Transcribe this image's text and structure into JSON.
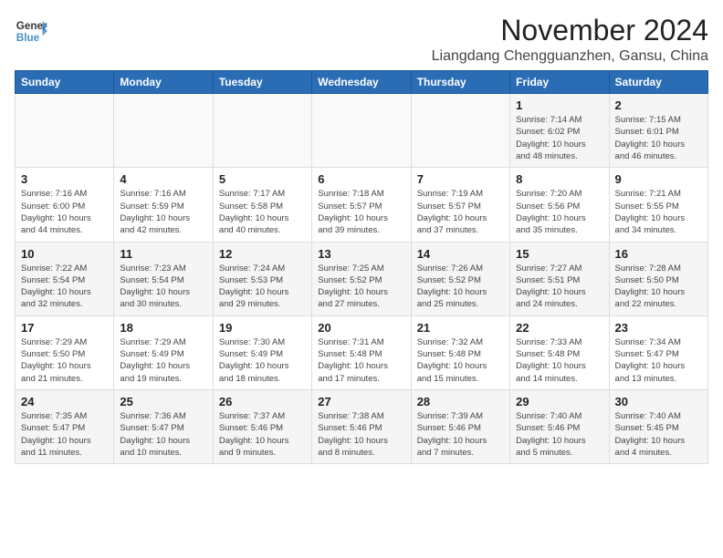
{
  "header": {
    "logo_line1": "General",
    "logo_line2": "Blue",
    "month": "November 2024",
    "location": "Liangdang Chengguanzhen, Gansu, China"
  },
  "weekdays": [
    "Sunday",
    "Monday",
    "Tuesday",
    "Wednesday",
    "Thursday",
    "Friday",
    "Saturday"
  ],
  "weeks": [
    [
      {
        "day": "",
        "info": ""
      },
      {
        "day": "",
        "info": ""
      },
      {
        "day": "",
        "info": ""
      },
      {
        "day": "",
        "info": ""
      },
      {
        "day": "",
        "info": ""
      },
      {
        "day": "1",
        "info": "Sunrise: 7:14 AM\nSunset: 6:02 PM\nDaylight: 10 hours\nand 48 minutes."
      },
      {
        "day": "2",
        "info": "Sunrise: 7:15 AM\nSunset: 6:01 PM\nDaylight: 10 hours\nand 46 minutes."
      }
    ],
    [
      {
        "day": "3",
        "info": "Sunrise: 7:16 AM\nSunset: 6:00 PM\nDaylight: 10 hours\nand 44 minutes."
      },
      {
        "day": "4",
        "info": "Sunrise: 7:16 AM\nSunset: 5:59 PM\nDaylight: 10 hours\nand 42 minutes."
      },
      {
        "day": "5",
        "info": "Sunrise: 7:17 AM\nSunset: 5:58 PM\nDaylight: 10 hours\nand 40 minutes."
      },
      {
        "day": "6",
        "info": "Sunrise: 7:18 AM\nSunset: 5:57 PM\nDaylight: 10 hours\nand 39 minutes."
      },
      {
        "day": "7",
        "info": "Sunrise: 7:19 AM\nSunset: 5:57 PM\nDaylight: 10 hours\nand 37 minutes."
      },
      {
        "day": "8",
        "info": "Sunrise: 7:20 AM\nSunset: 5:56 PM\nDaylight: 10 hours\nand 35 minutes."
      },
      {
        "day": "9",
        "info": "Sunrise: 7:21 AM\nSunset: 5:55 PM\nDaylight: 10 hours\nand 34 minutes."
      }
    ],
    [
      {
        "day": "10",
        "info": "Sunrise: 7:22 AM\nSunset: 5:54 PM\nDaylight: 10 hours\nand 32 minutes."
      },
      {
        "day": "11",
        "info": "Sunrise: 7:23 AM\nSunset: 5:54 PM\nDaylight: 10 hours\nand 30 minutes."
      },
      {
        "day": "12",
        "info": "Sunrise: 7:24 AM\nSunset: 5:53 PM\nDaylight: 10 hours\nand 29 minutes."
      },
      {
        "day": "13",
        "info": "Sunrise: 7:25 AM\nSunset: 5:52 PM\nDaylight: 10 hours\nand 27 minutes."
      },
      {
        "day": "14",
        "info": "Sunrise: 7:26 AM\nSunset: 5:52 PM\nDaylight: 10 hours\nand 25 minutes."
      },
      {
        "day": "15",
        "info": "Sunrise: 7:27 AM\nSunset: 5:51 PM\nDaylight: 10 hours\nand 24 minutes."
      },
      {
        "day": "16",
        "info": "Sunrise: 7:28 AM\nSunset: 5:50 PM\nDaylight: 10 hours\nand 22 minutes."
      }
    ],
    [
      {
        "day": "17",
        "info": "Sunrise: 7:29 AM\nSunset: 5:50 PM\nDaylight: 10 hours\nand 21 minutes."
      },
      {
        "day": "18",
        "info": "Sunrise: 7:29 AM\nSunset: 5:49 PM\nDaylight: 10 hours\nand 19 minutes."
      },
      {
        "day": "19",
        "info": "Sunrise: 7:30 AM\nSunset: 5:49 PM\nDaylight: 10 hours\nand 18 minutes."
      },
      {
        "day": "20",
        "info": "Sunrise: 7:31 AM\nSunset: 5:48 PM\nDaylight: 10 hours\nand 17 minutes."
      },
      {
        "day": "21",
        "info": "Sunrise: 7:32 AM\nSunset: 5:48 PM\nDaylight: 10 hours\nand 15 minutes."
      },
      {
        "day": "22",
        "info": "Sunrise: 7:33 AM\nSunset: 5:48 PM\nDaylight: 10 hours\nand 14 minutes."
      },
      {
        "day": "23",
        "info": "Sunrise: 7:34 AM\nSunset: 5:47 PM\nDaylight: 10 hours\nand 13 minutes."
      }
    ],
    [
      {
        "day": "24",
        "info": "Sunrise: 7:35 AM\nSunset: 5:47 PM\nDaylight: 10 hours\nand 11 minutes."
      },
      {
        "day": "25",
        "info": "Sunrise: 7:36 AM\nSunset: 5:47 PM\nDaylight: 10 hours\nand 10 minutes."
      },
      {
        "day": "26",
        "info": "Sunrise: 7:37 AM\nSunset: 5:46 PM\nDaylight: 10 hours\nand 9 minutes."
      },
      {
        "day": "27",
        "info": "Sunrise: 7:38 AM\nSunset: 5:46 PM\nDaylight: 10 hours\nand 8 minutes."
      },
      {
        "day": "28",
        "info": "Sunrise: 7:39 AM\nSunset: 5:46 PM\nDaylight: 10 hours\nand 7 minutes."
      },
      {
        "day": "29",
        "info": "Sunrise: 7:40 AM\nSunset: 5:46 PM\nDaylight: 10 hours\nand 5 minutes."
      },
      {
        "day": "30",
        "info": "Sunrise: 7:40 AM\nSunset: 5:45 PM\nDaylight: 10 hours\nand 4 minutes."
      }
    ]
  ]
}
